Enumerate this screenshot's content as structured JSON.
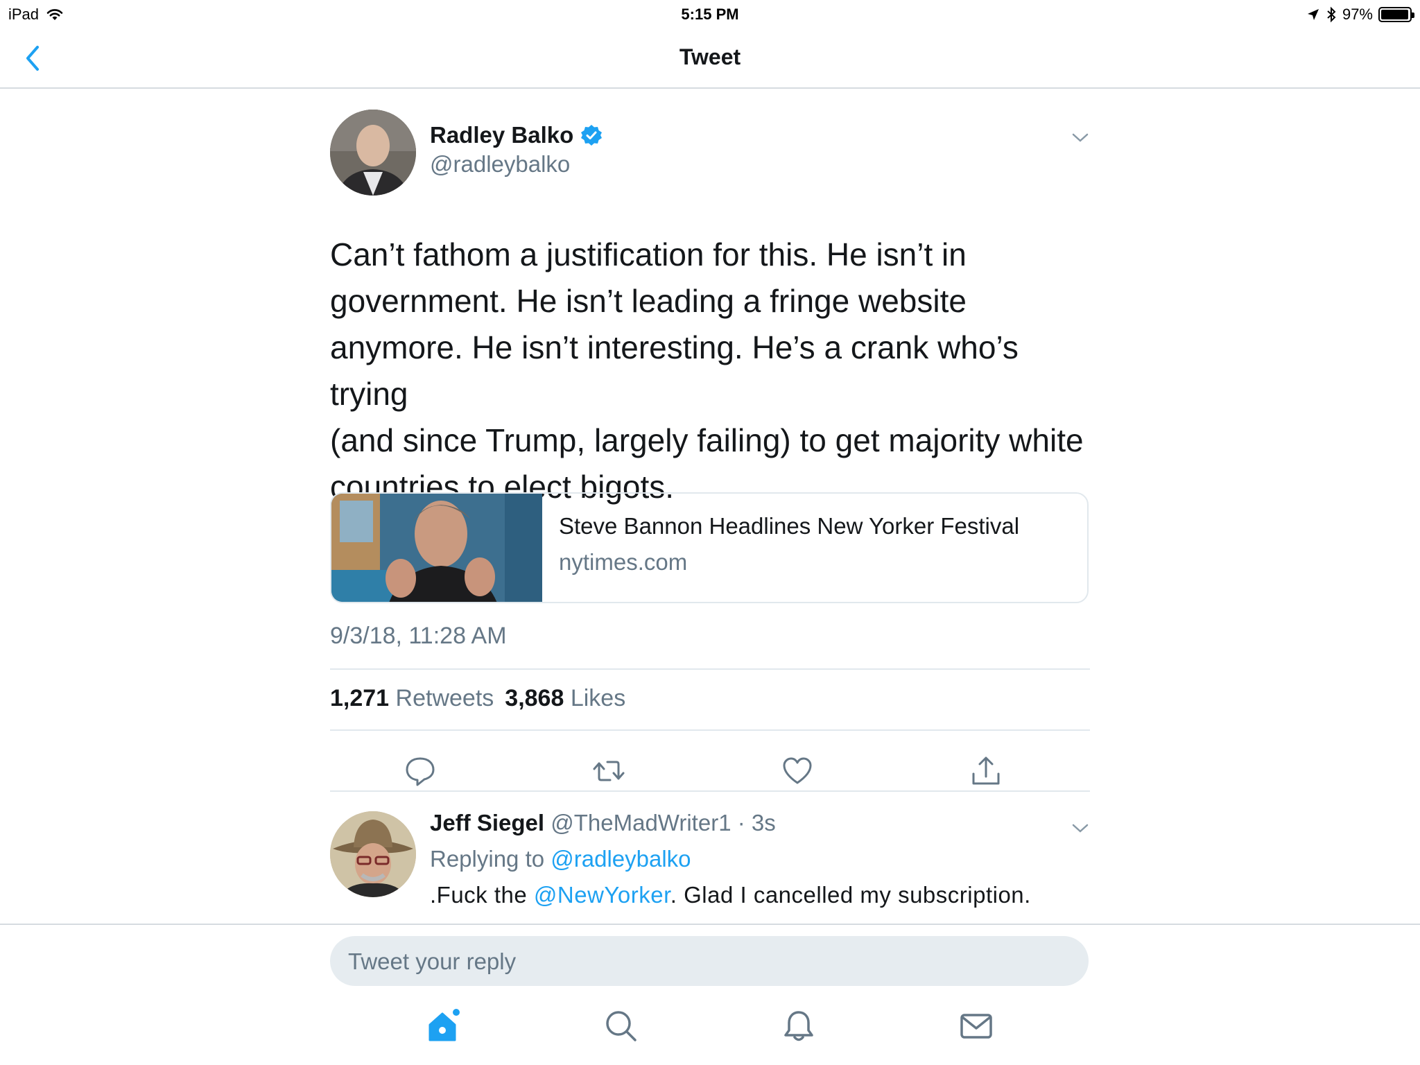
{
  "status_bar": {
    "device": "iPad",
    "time": "5:15 PM",
    "battery": "97%",
    "battery_level": 0.97
  },
  "nav": {
    "title": "Tweet"
  },
  "tweet": {
    "author_name": "Radley Balko",
    "author_handle": "@radleybalko",
    "verified": true,
    "text_lines": [
      "Can’t fathom a justification for this. He isn’t in",
      "government. He isn’t leading a fringe website",
      "anymore. He isn’t interesting. He’s a crank who’s trying",
      "(and since Trump, largely failing) to get majority white",
      "countries to elect bigots."
    ],
    "card": {
      "title": "Steve Bannon Headlines New Yorker Festival",
      "domain": "nytimes.com"
    },
    "timestamp": "9/3/18, 11:28 AM",
    "retweets_count": "1,271",
    "retweets_label": "Retweets",
    "likes_count": "3,868",
    "likes_label": "Likes"
  },
  "reply": {
    "name": "Jeff Siegel",
    "handle": "@TheMadWriter1",
    "separator": " · ",
    "age": "3s",
    "replying_prefix": "Replying to ",
    "replying_handle": "@radleybalko",
    "text_before": ".Fuck the ",
    "mention": "@NewYorker",
    "text_after": ". Glad I cancelled my subscription."
  },
  "composer": {
    "placeholder": "Tweet your reply"
  },
  "colors": {
    "accent": "#1da1f2",
    "secondary_text": "#657786",
    "primary_text": "#14171a",
    "divider": "#e1e8ed"
  },
  "icons": {
    "back": "chevron-left-icon",
    "verified": "verified-badge-icon",
    "caret": "chevron-down-icon",
    "reply": "speech-bubble-icon",
    "retweet": "retweet-icon",
    "like": "heart-icon",
    "share": "share-icon",
    "home": "home-icon",
    "search": "search-icon",
    "notifications": "bell-icon",
    "messages": "envelope-icon"
  }
}
